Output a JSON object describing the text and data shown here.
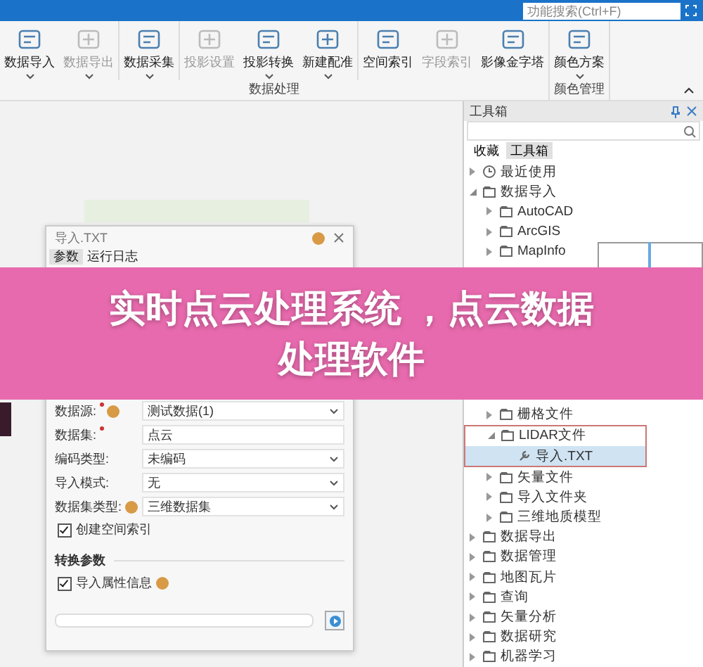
{
  "search": {
    "placeholder": "功能搜索(Ctrl+F)"
  },
  "ribbon": {
    "groups": [
      {
        "label": "数据处理",
        "tools": [
          {
            "label": "数据导入",
            "disabled": false,
            "dropdown": true,
            "separated": false
          },
          {
            "label": "数据导出",
            "disabled": true,
            "dropdown": true,
            "separated": false
          },
          {
            "label": "数据采集",
            "disabled": false,
            "dropdown": true,
            "separated": true
          },
          {
            "label": "投影设置",
            "disabled": true,
            "dropdown": false,
            "separated": true
          },
          {
            "label": "投影转换",
            "disabled": false,
            "dropdown": true,
            "separated": false
          },
          {
            "label": "新建配准",
            "disabled": false,
            "dropdown": true,
            "separated": false
          },
          {
            "label": "空间索引",
            "disabled": false,
            "dropdown": false,
            "separated": true
          },
          {
            "label": "字段索引",
            "disabled": true,
            "dropdown": false,
            "separated": false
          },
          {
            "label": "影像金字塔",
            "disabled": false,
            "dropdown": false,
            "separated": false
          }
        ]
      },
      {
        "label": "颜色管理",
        "tools": [
          {
            "label": "颜色方案",
            "disabled": false,
            "dropdown": true,
            "separated": false
          }
        ]
      }
    ]
  },
  "dialog": {
    "title": "导入.TXT",
    "tabs": [
      {
        "label": "参数",
        "selected": true
      },
      {
        "label": "运行日志",
        "selected": false
      }
    ],
    "rows": [
      {
        "kind": "select",
        "label": "数据源:",
        "value": "测试数据(1)",
        "required": true,
        "help": true
      },
      {
        "kind": "field",
        "label": "数据集:",
        "value": "点云",
        "required": true
      },
      {
        "kind": "select",
        "label": "编码类型:",
        "value": "未编码"
      },
      {
        "kind": "select",
        "label": "导入模式:",
        "value": "无"
      },
      {
        "kind": "select",
        "label": "数据集类型:",
        "value": "三维数据集",
        "help": true
      },
      {
        "kind": "checkbox",
        "label": "创建空间索引",
        "checked": true
      },
      {
        "kind": "section",
        "label": "转换参数"
      },
      {
        "kind": "checkbox",
        "label": "导入属性信息",
        "checked": true,
        "help": true
      }
    ],
    "progress": {
      "level": 0
    }
  },
  "toolbox": {
    "title": "工具箱",
    "tabs": [
      {
        "label": "收藏",
        "selected": false
      },
      {
        "label": "工具箱",
        "selected": true
      }
    ],
    "tree": [
      {
        "label": "最近使用",
        "kind": "recent",
        "expanded": false,
        "selected": false
      },
      {
        "label": "数据导入",
        "kind": "folder",
        "expanded": true,
        "selected": false,
        "children": [
          {
            "label": "AutoCAD",
            "kind": "folder",
            "expanded": false,
            "selected": false
          },
          {
            "label": "ArcGIS",
            "kind": "folder",
            "expanded": false,
            "selected": false
          },
          {
            "label": "MapInfo",
            "kind": "folder",
            "expanded": false,
            "selected": false
          },
          {
            "label": "栅格文件",
            "kind": "folder",
            "expanded": false,
            "selected": false,
            "below_banner": true
          },
          {
            "label": "LIDAR文件",
            "kind": "folder",
            "expanded": true,
            "selected": false,
            "children": [
              {
                "label": "导入.TXT",
                "kind": "tool",
                "expanded": false,
                "selected": true
              }
            ]
          },
          {
            "label": "矢量文件",
            "kind": "folder",
            "expanded": false,
            "selected": false
          },
          {
            "label": "导入文件夹",
            "kind": "folder",
            "expanded": false,
            "selected": false
          },
          {
            "label": "三维地质模型",
            "kind": "folder",
            "expanded": false,
            "selected": false
          }
        ]
      },
      {
        "label": "数据导出",
        "kind": "folder",
        "expanded": false,
        "selected": false
      },
      {
        "label": "数据管理",
        "kind": "folder",
        "expanded": false,
        "selected": false
      },
      {
        "label": "地图瓦片",
        "kind": "folder",
        "expanded": false,
        "selected": false
      },
      {
        "label": "查询",
        "kind": "folder",
        "expanded": false,
        "selected": false
      },
      {
        "label": "矢量分析",
        "kind": "folder",
        "expanded": false,
        "selected": false
      },
      {
        "label": "数据研究",
        "kind": "folder",
        "expanded": false,
        "selected": false
      },
      {
        "label": "机器学习",
        "kind": "folder",
        "expanded": false,
        "selected": false
      }
    ]
  },
  "banner": {
    "lines": [
      "实时点云处理系统 ，点云数据",
      "处理软件"
    ]
  }
}
